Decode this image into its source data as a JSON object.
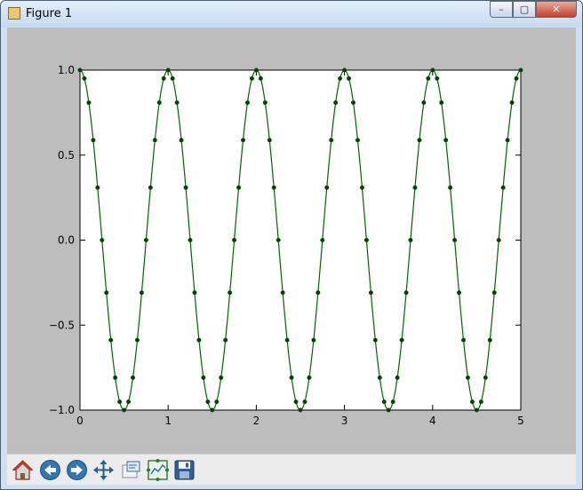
{
  "window": {
    "title": "Figure 1",
    "close_glyph": "✕",
    "maximize_glyph": "▢",
    "minimize_glyph": "–"
  },
  "toolbar": {
    "buttons": [
      {
        "name": "home-button",
        "icon": "home-icon"
      },
      {
        "name": "back-button",
        "icon": "back-arrow-icon"
      },
      {
        "name": "forward-button",
        "icon": "forward-arrow-icon"
      },
      {
        "name": "pan-button",
        "icon": "move-icon"
      },
      {
        "name": "zoom-button",
        "icon": "zoom-rect-icon"
      },
      {
        "name": "subplots-button",
        "icon": "configure-subplots-icon"
      },
      {
        "name": "save-button",
        "icon": "save-icon"
      }
    ]
  },
  "colors": {
    "line": "#006400",
    "marker": "#0a3a0a",
    "axes_bg": "#ffffff",
    "figure_bg": "#bdbdbd"
  },
  "chart_data": {
    "type": "line",
    "title": "",
    "xlabel": "",
    "ylabel": "",
    "xlim": [
      0,
      5
    ],
    "ylim": [
      -1.0,
      1.0
    ],
    "xticks": [
      "0",
      "1",
      "2",
      "3",
      "4",
      "5"
    ],
    "yticks": [
      "1.0",
      "0.5",
      "0.0",
      "−0.5",
      "−1.0"
    ],
    "grid": false,
    "series": [
      {
        "function": "cos(2*pi*x)",
        "x": [
          0.0,
          0.05,
          0.1,
          0.15,
          0.2,
          0.25,
          0.3,
          0.35,
          0.4,
          0.45,
          0.5,
          0.55,
          0.6,
          0.65,
          0.7,
          0.75,
          0.8,
          0.85,
          0.9,
          0.95,
          1.0,
          1.05,
          1.1,
          1.15,
          1.2,
          1.25,
          1.3,
          1.35,
          1.4,
          1.45,
          1.5,
          1.55,
          1.6,
          1.65,
          1.7,
          1.75,
          1.8,
          1.85,
          1.9,
          1.95,
          2.0,
          2.05,
          2.1,
          2.15,
          2.2,
          2.25,
          2.3,
          2.35,
          2.4,
          2.45,
          2.5,
          2.55,
          2.6,
          2.65,
          2.7,
          2.75,
          2.8,
          2.85,
          2.9,
          2.95,
          3.0,
          3.05,
          3.1,
          3.15,
          3.2,
          3.25,
          3.3,
          3.35,
          3.4,
          3.45,
          3.5,
          3.55,
          3.6,
          3.65,
          3.7,
          3.75,
          3.8,
          3.85,
          3.9,
          3.95,
          4.0,
          4.05,
          4.1,
          4.15,
          4.2,
          4.25,
          4.3,
          4.35,
          4.4,
          4.45,
          4.5,
          4.55,
          4.6,
          4.65,
          4.7,
          4.75,
          4.8,
          4.85,
          4.9,
          4.95,
          5.0
        ],
        "y": [
          1.0,
          0.951,
          0.809,
          0.588,
          0.309,
          0.0,
          -0.309,
          -0.588,
          -0.809,
          -0.951,
          -1.0,
          -0.951,
          -0.809,
          -0.588,
          -0.309,
          0.0,
          0.309,
          0.588,
          0.809,
          0.951,
          1.0,
          0.951,
          0.809,
          0.588,
          0.309,
          0.0,
          -0.309,
          -0.588,
          -0.809,
          -0.951,
          -1.0,
          -0.951,
          -0.809,
          -0.588,
          -0.309,
          0.0,
          0.309,
          0.588,
          0.809,
          0.951,
          1.0,
          0.951,
          0.809,
          0.588,
          0.309,
          0.0,
          -0.309,
          -0.588,
          -0.809,
          -0.951,
          -1.0,
          -0.951,
          -0.809,
          -0.588,
          -0.309,
          0.0,
          0.309,
          0.588,
          0.809,
          0.951,
          1.0,
          0.951,
          0.809,
          0.588,
          0.309,
          0.0,
          -0.309,
          -0.588,
          -0.809,
          -0.951,
          -1.0,
          -0.951,
          -0.809,
          -0.588,
          -0.309,
          0.0,
          0.309,
          0.588,
          0.809,
          0.951,
          1.0,
          0.951,
          0.809,
          0.588,
          0.309,
          0.0,
          -0.309,
          -0.588,
          -0.809,
          -0.951,
          -1.0,
          -0.951,
          -0.809,
          -0.588,
          -0.309,
          0.0,
          0.309,
          0.588,
          0.809,
          0.951,
          1.0
        ]
      }
    ]
  }
}
